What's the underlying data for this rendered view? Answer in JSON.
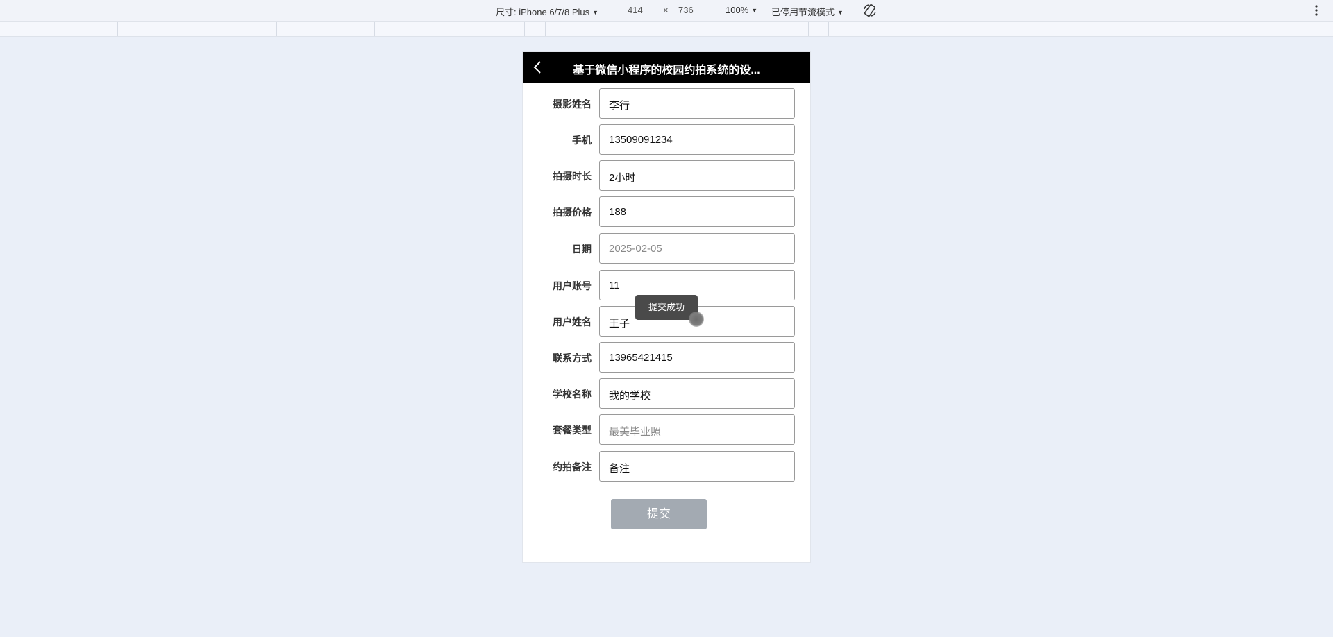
{
  "devtools": {
    "device_label": "尺寸: iPhone 6/7/8 Plus",
    "width": "414",
    "times": "×",
    "height": "736",
    "zoom": "100%",
    "throttle": "已停用节流模式",
    "rotate_icon": "rotate-icon",
    "menu_icon": "vertical-dots-icon"
  },
  "navbar": {
    "title": "基于微信小程序的校园约拍系统的设...",
    "back_icon": "chevron-left-icon"
  },
  "form": {
    "fields": [
      {
        "label": "摄影姓名",
        "value": "李行",
        "placeholder": false
      },
      {
        "label": "手机",
        "value": "13509091234",
        "placeholder": false
      },
      {
        "label": "拍摄时长",
        "value": "2小时",
        "placeholder": false
      },
      {
        "label": "拍摄价格",
        "value": "188",
        "placeholder": false
      },
      {
        "label": "日期",
        "value": "2025-02-05",
        "placeholder": true
      },
      {
        "label": "用户账号",
        "value": "11",
        "placeholder": false
      },
      {
        "label": "用户姓名",
        "value": "王子",
        "placeholder": false
      },
      {
        "label": "联系方式",
        "value": "13965421415",
        "placeholder": false
      },
      {
        "label": "学校名称",
        "value": "我的学校",
        "placeholder": false
      },
      {
        "label": "套餐类型",
        "value": "最美毕业照",
        "placeholder": true
      },
      {
        "label": "约拍备注",
        "value": "备注",
        "placeholder": false
      }
    ],
    "submit_label": "提交"
  },
  "toast": {
    "text": "提交成功"
  },
  "colors": {
    "page_bg": "#eaeff8",
    "navbar_bg": "#000000",
    "button_bg": "#a3aab2",
    "toast_bg": "#4a4a4a"
  }
}
